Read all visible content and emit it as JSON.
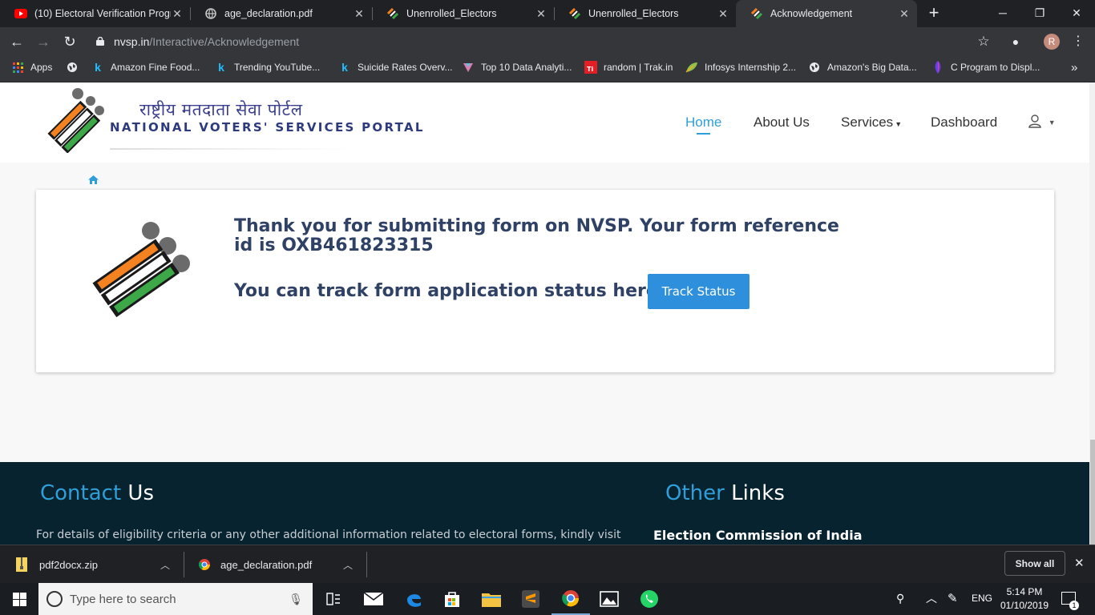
{
  "browser": {
    "tabs": [
      {
        "title": "(10) Electoral Verification Progr",
        "icon": "youtube-icon"
      },
      {
        "title": "age_declaration.pdf",
        "icon": "globe-icon"
      },
      {
        "title": "Unenrolled_Electors",
        "icon": "eci-logo-icon"
      },
      {
        "title": "Unenrolled_Electors",
        "icon": "eci-logo-icon"
      },
      {
        "title": "Acknowledgement",
        "icon": "eci-logo-icon",
        "active": true
      }
    ],
    "url_host": "nvsp.in",
    "url_path": "/Interactive/Acknowledgement",
    "profile_initial": "R",
    "bookmarks": [
      {
        "label": "Apps",
        "icon": "apps-grid-icon"
      },
      {
        "label": "",
        "icon": "globe-icon"
      },
      {
        "label": "Amazon Fine Food...",
        "icon": "kaggle-icon"
      },
      {
        "label": "Trending YouTube...",
        "icon": "kaggle-icon"
      },
      {
        "label": "Suicide Rates Overv...",
        "icon": "kaggle-icon"
      },
      {
        "label": "Top 10 Data Analyti...",
        "icon": "heart-pin-icon"
      },
      {
        "label": "random | Trak.in",
        "icon": "trak-icon"
      },
      {
        "label": "Infosys Internship 2...",
        "icon": "leaf-icon"
      },
      {
        "label": "Amazon's Big Data...",
        "icon": "globe-icon"
      },
      {
        "label": "C Program to Displ...",
        "icon": "feather-icon"
      }
    ]
  },
  "site": {
    "logo_hindi": "राष्ट्रीय मतदाता सेवा पोर्टल",
    "logo_english": "NATIONAL VOTERS' SERVICES PORTAL",
    "nav": {
      "home": "Home",
      "about": "About Us",
      "services": "Services",
      "dashboard": "Dashboard"
    },
    "thanks_message": "Thank you for submitting form on NVSP. Your form reference id is OXB461823315",
    "track_message": "You can track form application status here...",
    "track_button": "Track Status",
    "footer": {
      "contact_a": "Contact",
      "contact_b": " Us",
      "other_a": "Other",
      "other_b": " Links",
      "contact_text": "For details of eligibility criteria or any other additional information related to electoral forms, kindly visit",
      "eci_link": "Election Commission of India"
    }
  },
  "downloads": [
    {
      "name": "pdf2docx.zip",
      "icon": "zip-file-icon"
    },
    {
      "name": "age_declaration.pdf",
      "icon": "chrome-icon"
    }
  ],
  "downloads_show_all": "Show all",
  "taskbar": {
    "search_placeholder": "Type here to search",
    "language": "ENG",
    "time": "5:14 PM",
    "date": "01/10/2019",
    "notification_count": "1"
  }
}
